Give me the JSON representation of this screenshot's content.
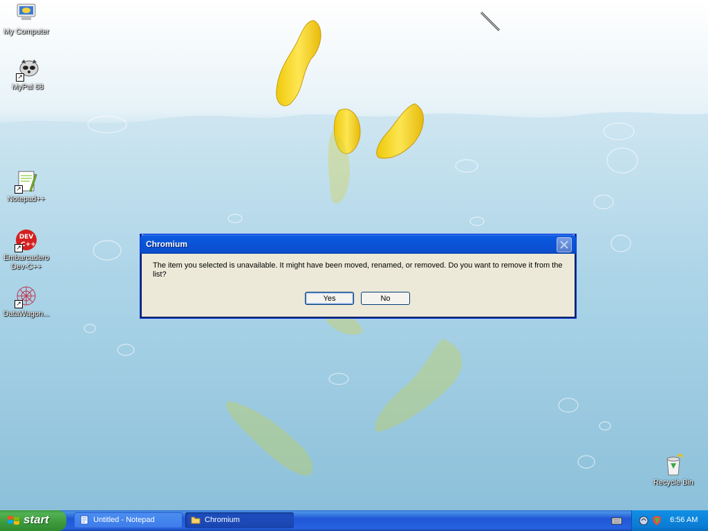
{
  "desktop": {
    "icons": [
      {
        "label": "My Computer"
      },
      {
        "label": "MyPal 68"
      },
      {
        "label": "Notepad++"
      },
      {
        "label": "Embarcadero Dev-C++"
      },
      {
        "label": "DataWagon..."
      },
      {
        "label": "Recycle Bin"
      }
    ]
  },
  "dialog": {
    "title": "Chromium",
    "message": "The item you selected is unavailable.  It might have been moved, renamed, or removed.  Do you want to remove it from the list?",
    "yes_label": "Yes",
    "no_label": "No"
  },
  "taskbar": {
    "start_label": "start",
    "tasks": [
      {
        "label": "Untitled - Notepad",
        "icon": "notepad-icon"
      },
      {
        "label": "Chromium",
        "icon": "folder-icon"
      }
    ],
    "clock": "6:56 AM"
  },
  "colors": {
    "taskbar_blue": "#245edb",
    "start_green": "#3c9a3c",
    "title_blue": "#0a4fce",
    "dialog_bg": "#ece9d8"
  }
}
